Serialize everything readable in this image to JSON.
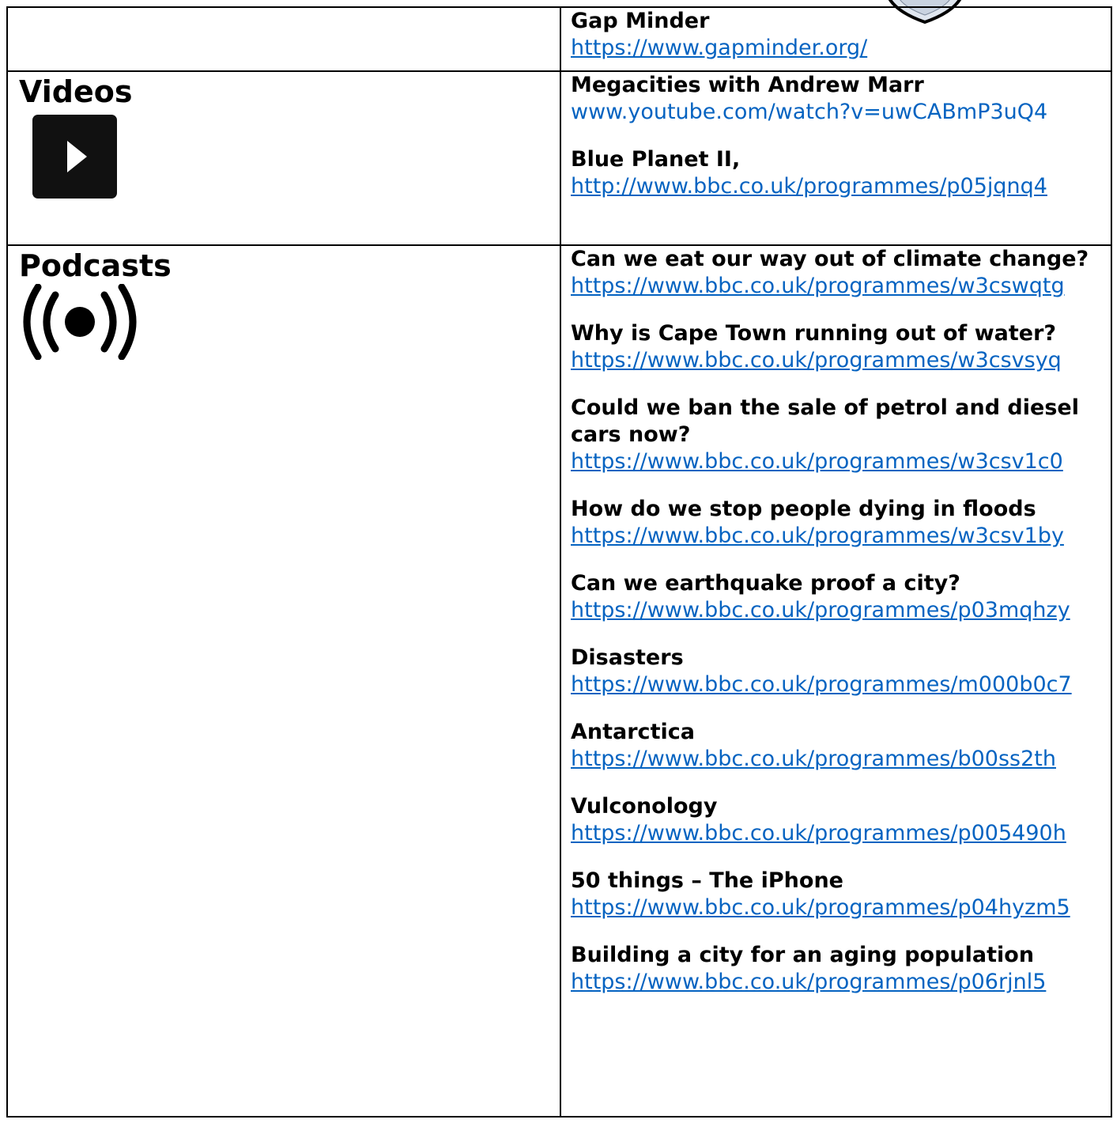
{
  "top_resources": [
    {
      "title": "Gap Minder",
      "url": "https://www.gapminder.org/"
    }
  ],
  "videos": {
    "heading": "Videos",
    "icon": "play-icon",
    "items": [
      {
        "title": "Megacities with Andrew Marr",
        "url": "www.youtube.com/watch?v=uwCABmP3uQ4"
      },
      {
        "title": "Blue Planet II,",
        "url": "http://www.bbc.co.uk/programmes/p05jqnq4"
      }
    ]
  },
  "podcasts": {
    "heading": "Podcasts",
    "icon": "broadcast-icon",
    "items": [
      {
        "title": "Can we eat our way out of climate change?",
        "url": "https://www.bbc.co.uk/programmes/w3cswqtg"
      },
      {
        "title": "Why is Cape Town running out of water?",
        "url": "https://www.bbc.co.uk/programmes/w3csvsyq"
      },
      {
        "title": "Could we ban the sale of petrol and diesel cars now?",
        "url": "https://www.bbc.co.uk/programmes/w3csv1c0"
      },
      {
        "title": "How do we stop people dying in floods",
        "url": "https://www.bbc.co.uk/programmes/w3csv1by"
      },
      {
        "title": "Can we earthquake proof a city?",
        "url": "https://www.bbc.co.uk/programmes/p03mqhzy"
      },
      {
        "title": "Disasters",
        "url": "https://www.bbc.co.uk/programmes/m000b0c7"
      },
      {
        "title": "Antarctica",
        "url": "https://www.bbc.co.uk/programmes/b00ss2th"
      },
      {
        "title": "Vulconology",
        "url": "https://www.bbc.co.uk/programmes/p005490h"
      },
      {
        "title": "50 things – The iPhone",
        "url": "https://www.bbc.co.uk/programmes/p04hyzm5"
      },
      {
        "title": "Building a city for an aging population",
        "url": "https://www.bbc.co.uk/programmes/p06rjnl5"
      }
    ]
  },
  "colors": {
    "link": "#0563c1",
    "border": "#000000"
  }
}
